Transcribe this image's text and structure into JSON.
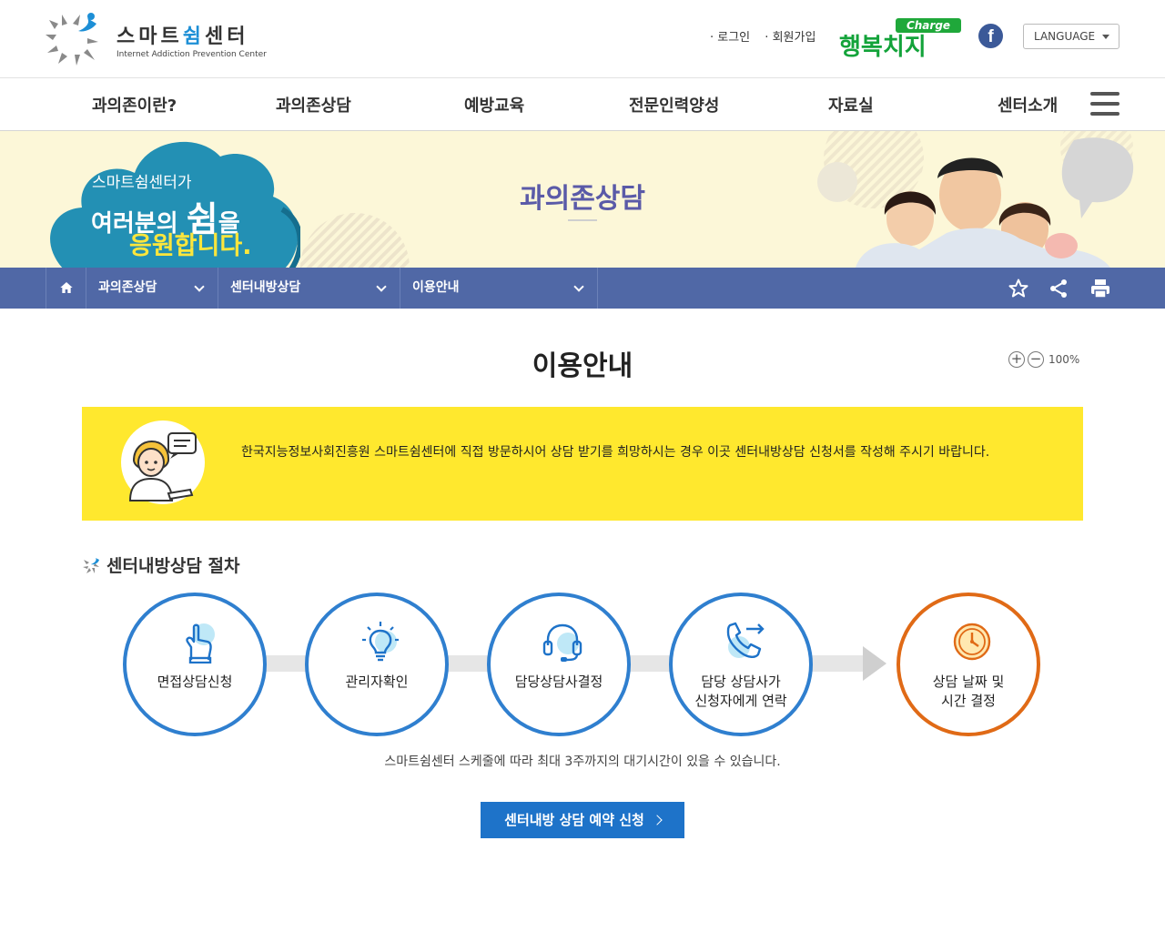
{
  "header": {
    "logo_title_a": "스마트",
    "logo_title_hl": "쉼",
    "logo_title_b": "센터",
    "logo_subtitle": "Internet Addiction Prevention Center",
    "login": "로그인",
    "join": "회원가입",
    "charge_tag": "Charge",
    "charge_main": "행복치지",
    "facebook_glyph": "f",
    "language": "LANGUAGE"
  },
  "gnb": [
    "과의존이란?",
    "과의존상담",
    "예방교육",
    "전문인력양성",
    "자료실",
    "센터소개"
  ],
  "banner": {
    "line1": "스마트쉼센터가",
    "line2_a": "여러분의 ",
    "line2_big": "쉼",
    "line2_b": "을",
    "line3": "응원합니다.",
    "title": "과의존상담"
  },
  "location": {
    "depth1": "과의존상담",
    "depth2": "센터내방상담",
    "depth3": "이용안내"
  },
  "content": {
    "page_title": "이용안내",
    "zoom_plus": "+",
    "zoom_minus": "−",
    "zoom_level": "100%",
    "notice": "한국지능정보사회진흥원 스마트쉼센터에 직접 방문하시어 상담 받기를 희망하시는 경우 이곳 센터내방상담 신청서를 작성해 주시기 바랍니다.",
    "section_title": "센터내방상담 절차",
    "steps": [
      {
        "label": "면접상담신청",
        "icon": "hand-touch-icon"
      },
      {
        "label": "관리자확인",
        "icon": "lightbulb-icon"
      },
      {
        "label": "담당상담사결정",
        "icon": "headset-icon"
      },
      {
        "label": "담당 상담사가\n신청자에게 연락",
        "icon": "phone-call-icon"
      },
      {
        "label": "상담 날짜 및\n시간 결정",
        "icon": "clock-icon"
      }
    ],
    "note": "스마트쉼센터 스케줄에 따라 최대 3주까지의 대기시간이 있을 수 있습니다.",
    "reserve_button": "센터내방 상담 예약 신청"
  },
  "colors": {
    "location_bar": "#5068a6",
    "notice_bg": "#ffe82e",
    "step_border": "#2f7fcf",
    "step_last_border": "#e06a16",
    "button": "#1e73c9"
  }
}
